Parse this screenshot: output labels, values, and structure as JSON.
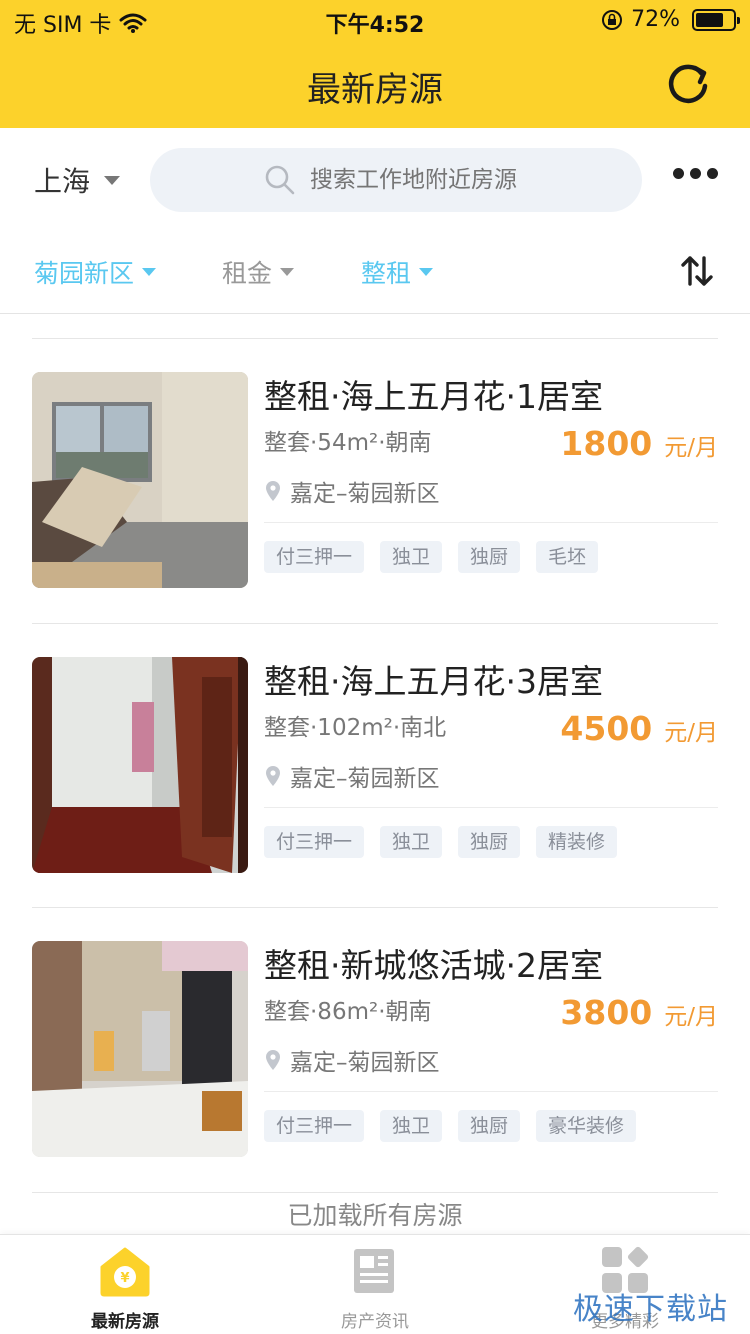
{
  "status_bar": {
    "carrier": "无 SIM 卡",
    "time": "下午4:52",
    "battery": "72%"
  },
  "nav": {
    "title": "最新房源"
  },
  "search": {
    "city": "上海",
    "placeholder": "搜索工作地附近房源"
  },
  "filters": [
    {
      "label": "菊园新区",
      "color": "#5ac8f0"
    },
    {
      "label": "租金",
      "color": "#999999"
    },
    {
      "label": "整租",
      "color": "#5ac8f0"
    }
  ],
  "listings": [
    {
      "title": "整租·海上五月花·1居室",
      "sub": "整套·54m²·朝南",
      "price": "1800",
      "unit": "元/月",
      "location": "嘉定–菊园新区",
      "tags": [
        "付三押一",
        "独卫",
        "独厨",
        "毛坯"
      ]
    },
    {
      "title": "整租·海上五月花·3居室",
      "sub": "整套·102m²·南北",
      "price": "4500",
      "unit": "元/月",
      "location": "嘉定–菊园新区",
      "tags": [
        "付三押一",
        "独卫",
        "独厨",
        "精装修"
      ]
    },
    {
      "title": "整租·新城悠活城·2居室",
      "sub": "整套·86m²·朝南",
      "price": "3800",
      "unit": "元/月",
      "location": "嘉定–菊园新区",
      "tags": [
        "付三押一",
        "独卫",
        "独厨",
        "豪华装修"
      ]
    }
  ],
  "end_note": "已加载所有房源",
  "tabbar": [
    {
      "label": "最新房源",
      "active": true
    },
    {
      "label": "房产资讯",
      "active": false
    },
    {
      "label": "更多精彩",
      "active": false
    }
  ],
  "watermark": "极速下载站",
  "colors": {
    "accent": "#fcd22b",
    "price": "#f29a33",
    "filter_active": "#5ac8f0"
  }
}
